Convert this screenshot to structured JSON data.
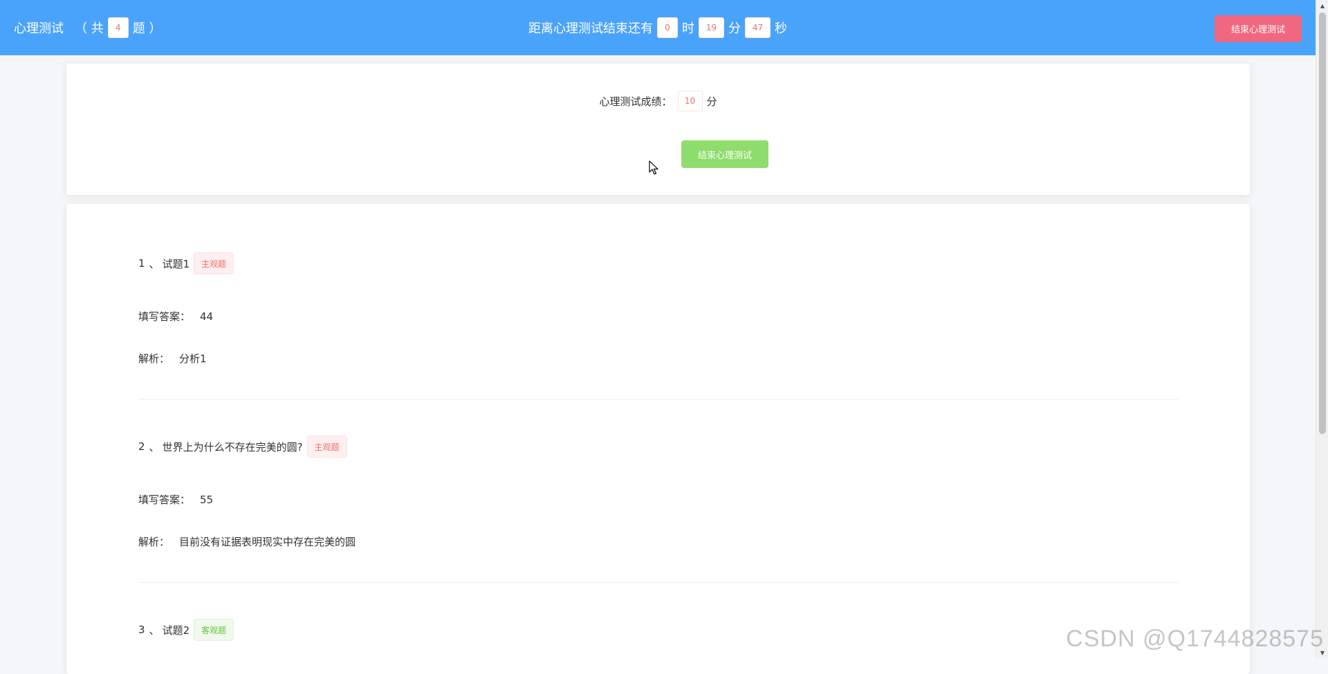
{
  "header": {
    "title": "心理测试",
    "count_prefix": "（ 共",
    "count_value": "4",
    "count_suffix": "题 ）",
    "countdown_label": "距离心理测试结束还有",
    "hours": "0",
    "hours_unit": "时",
    "minutes": "19",
    "minutes_unit": "分",
    "seconds": "47",
    "seconds_unit": "秒",
    "end_button_label": "结束心理测试"
  },
  "score": {
    "label": "心理测试成绩：",
    "value": "10",
    "unit": "分",
    "end_button_label": "结束心理测试"
  },
  "questions": [
    {
      "number": "1",
      "separator": "、",
      "title": "试题1",
      "type_label": "主观题",
      "answer_label": "填写答案：",
      "answer": "44",
      "analysis_label": "解析：",
      "analysis": "分析1"
    },
    {
      "number": "2",
      "separator": "、",
      "title": "世界上为什么不存在完美的圆?",
      "type_label": "主观题",
      "answer_label": "填写答案：",
      "answer": "55",
      "analysis_label": "解析：",
      "analysis": "目前没有证据表明现实中存在完美的圆"
    },
    {
      "number": "3",
      "separator": "、",
      "title": "试题2",
      "type_label": "客观题"
    }
  ],
  "watermark": "CSDN @Q1744828575",
  "colors": {
    "header_bg": "#4aa3fb",
    "danger": "#f0687f",
    "success": "#8fdd6d",
    "tag_subjective": "#f56c6c",
    "tag_objective": "#67c23a"
  },
  "icons": {
    "cursor": "mouse-pointer-icon",
    "scroll_up": "triangle-up-icon",
    "scroll_down": "triangle-down-icon"
  }
}
